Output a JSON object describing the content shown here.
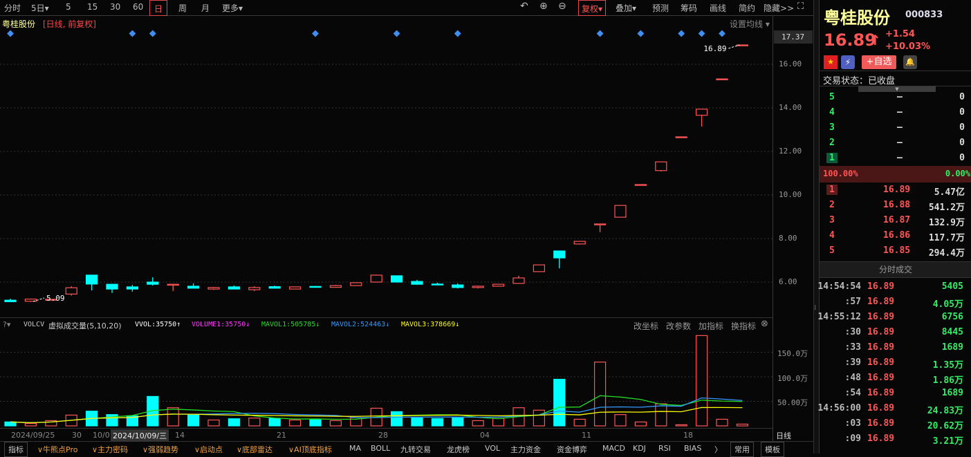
{
  "toolbar": {
    "left": [
      "分时",
      "5日▾",
      "5",
      "15",
      "30",
      "60",
      "日",
      "周",
      "月",
      "更多▾"
    ],
    "selected": "日",
    "right": [
      "复权▾",
      "叠加▾",
      "预测",
      "筹码",
      "画线",
      "简约",
      "隐藏>>"
    ],
    "icons": [
      "undo-icon",
      "zoom-in-icon",
      "zoom-out-icon",
      "fullscreen-icon"
    ]
  },
  "chart": {
    "stock_name": "粤桂股份",
    "mode": "[日线, 前复权]",
    "ma_setting": "设置均线 ▾",
    "price_labels": [
      "16.00",
      "14.00",
      "12.00",
      "10.00",
      "8.00",
      "6.00"
    ],
    "current_price_label": "17.37",
    "high_annotation": "16.89",
    "low_annotation": "5.09",
    "colors": {
      "up": "#ff5555",
      "down": "#00ffff",
      "marker": "#3f8ef0"
    }
  },
  "chart_data": {
    "type": "candlestick",
    "dates": [
      "09/25",
      "09/26",
      "09/27",
      "09/30",
      "10/08",
      "10/09",
      "10/10",
      "10/11",
      "10/14",
      "10/15",
      "10/16",
      "10/17",
      "10/18",
      "10/21",
      "10/22",
      "10/23",
      "10/24",
      "10/25",
      "10/28",
      "10/29",
      "10/30",
      "10/31",
      "11/01",
      "11/04",
      "11/05",
      "11/06",
      "11/07",
      "11/08",
      "11/11",
      "11/12",
      "11/13",
      "11/14",
      "11/15",
      "11/18",
      "11/19",
      "11/20",
      "11/21"
    ],
    "ohlc": [
      [
        5.17,
        5.24,
        5.08,
        5.1
      ],
      [
        5.12,
        5.24,
        5.09,
        5.22
      ],
      [
        5.2,
        5.22,
        5.19,
        5.21
      ],
      [
        5.45,
        5.81,
        5.38,
        5.74
      ],
      [
        6.32,
        6.33,
        5.62,
        5.91
      ],
      [
        5.9,
        5.9,
        5.5,
        5.68
      ],
      [
        5.78,
        5.87,
        5.56,
        5.68
      ],
      [
        6.0,
        6.22,
        5.84,
        5.9
      ],
      [
        5.89,
        5.9,
        5.59,
        5.9
      ],
      [
        5.81,
        5.94,
        5.72,
        5.72
      ],
      [
        5.68,
        5.78,
        5.64,
        5.75
      ],
      [
        5.78,
        5.84,
        5.68,
        5.68
      ],
      [
        5.65,
        5.81,
        5.59,
        5.75
      ],
      [
        5.79,
        5.84,
        5.72,
        5.72
      ],
      [
        5.68,
        5.8,
        5.68,
        5.78
      ],
      [
        5.8,
        5.82,
        5.77,
        5.79
      ],
      [
        5.76,
        5.87,
        5.76,
        5.84
      ],
      [
        5.84,
        5.99,
        5.84,
        5.97
      ],
      [
        6.0,
        6.34,
        5.99,
        6.32
      ],
      [
        6.29,
        6.29,
        6.0,
        6.0
      ],
      [
        6.03,
        6.1,
        5.87,
        5.9
      ],
      [
        5.91,
        5.97,
        5.88,
        5.88
      ],
      [
        5.87,
        5.94,
        5.71,
        5.75
      ],
      [
        5.75,
        5.84,
        5.71,
        5.81
      ],
      [
        5.81,
        5.9,
        5.81,
        5.9
      ],
      [
        5.94,
        6.29,
        5.94,
        6.19
      ],
      [
        6.48,
        6.79,
        6.48,
        6.79
      ],
      [
        7.43,
        7.43,
        6.63,
        7.11
      ],
      [
        7.75,
        7.87,
        7.72,
        7.87
      ],
      [
        8.66,
        8.67,
        8.29,
        8.67
      ],
      [
        8.98,
        9.52,
        8.98,
        9.52
      ],
      [
        10.48,
        10.48,
        10.48,
        10.48
      ],
      [
        11.12,
        11.52,
        11.08,
        11.52
      ],
      [
        12.67,
        12.67,
        12.67,
        12.67
      ],
      [
        13.66,
        13.94,
        13.14,
        13.94
      ],
      [
        15.33,
        15.33,
        15.33,
        15.33
      ],
      [
        16.89,
        16.89,
        16.89,
        16.89
      ]
    ],
    "signal_marker_indices": [
      0,
      6,
      7,
      15,
      19,
      22,
      29,
      31,
      33,
      34,
      35
    ],
    "volume_wan": [
      8,
      5,
      10.7,
      22,
      30,
      23,
      20.5,
      60,
      37,
      22,
      12,
      14.5,
      16,
      15.4,
      12,
      13,
      10.7,
      17,
      36,
      29,
      16.3,
      15,
      16.3,
      10.7,
      15,
      37,
      32,
      95,
      13.5,
      130,
      23,
      8,
      45,
      2.3,
      184,
      13.5,
      3.6
    ],
    "volume_axis_labels": [
      "150.0万",
      "100.0万",
      "50.00万"
    ],
    "date_axis_labels": [
      "2024/09/25",
      "30",
      "10/0",
      "14",
      "21",
      "28",
      "04",
      "11",
      "18"
    ],
    "ylim": [
      4.7,
      17.6
    ]
  },
  "volume_panel": {
    "name": "VOLCV",
    "title": "虚拟成交量(5,10,20)",
    "vvol": "VVOL:35750↑",
    "volume1": "VOLUME1:35750↓",
    "mavol1": "MAVOL1:505785↓",
    "mavol2": "MAVOL2:524463↓",
    "mavol3": "MAVOL3:378669↓",
    "actions": [
      "改坐标",
      "改参数",
      "加指标",
      "换指标"
    ],
    "colors": {
      "volume1": "#ff33ff",
      "mavol1": "#22dd22",
      "mavol2": "#3399ff",
      "mavol3": "#ffff00"
    }
  },
  "date_axis": {
    "tooltip": "2024/10/09/三",
    "period": "日线"
  },
  "bottom_tabs": {
    "first": "指标",
    "custom": [
      "∨牛熊点Pro",
      "∨主力密码",
      "∨强弱趋势",
      "∨启动点",
      "∨底部雷达",
      "∨AI顶底指标"
    ],
    "standard": [
      "MA",
      "BOLL",
      "九转交易",
      "龙虎榜",
      "VOL",
      "主力资金",
      "资金博弈",
      "MACD",
      "KDJ",
      "RSI",
      "BIAS"
    ],
    "more": "〉",
    "common": "常用",
    "template": "模板"
  },
  "quote": {
    "name": "粤桂股份",
    "code": "000833",
    "price": "16.89",
    "arrow": "↑",
    "change": "+1.54",
    "change_pct": "+10.03%",
    "watch_button": "+自选",
    "status": "交易状态：已收盘",
    "asks": [
      {
        "level": "5",
        "price": "—",
        "vol": "0"
      },
      {
        "level": "4",
        "price": "—",
        "vol": "0"
      },
      {
        "level": "3",
        "price": "—",
        "vol": "0"
      },
      {
        "level": "2",
        "price": "—",
        "vol": "0"
      },
      {
        "level": "1",
        "price": "—",
        "vol": "0"
      }
    ],
    "ratio_buy": "100.00%",
    "ratio_sell": "0.00%",
    "bids": [
      {
        "level": "1",
        "price": "16.89",
        "vol": "5.47亿"
      },
      {
        "level": "2",
        "price": "16.88",
        "vol": "541.2万"
      },
      {
        "level": "3",
        "price": "16.87",
        "vol": "132.9万"
      },
      {
        "level": "4",
        "price": "16.86",
        "vol": "117.7万"
      },
      {
        "level": "5",
        "price": "16.85",
        "vol": "294.4万"
      }
    ],
    "trades_title": "分时成交",
    "trades": [
      {
        "t": "14:54:54",
        "p": "16.89",
        "v": "5405"
      },
      {
        "t": ":57",
        "p": "16.89",
        "v": "4.05万"
      },
      {
        "t": "14:55:12",
        "p": "16.89",
        "v": "6756"
      },
      {
        "t": ":30",
        "p": "16.89",
        "v": "8445"
      },
      {
        "t": ":33",
        "p": "16.89",
        "v": "1689"
      },
      {
        "t": ":39",
        "p": "16.89",
        "v": "1.35万"
      },
      {
        "t": ":48",
        "p": "16.89",
        "v": "1.86万"
      },
      {
        "t": ":54",
        "p": "16.89",
        "v": "1689"
      },
      {
        "t": "14:56:00",
        "p": "16.89",
        "v": "24.83万"
      },
      {
        "t": ":03",
        "p": "16.89",
        "v": "20.62万"
      },
      {
        "t": ":09",
        "p": "16.89",
        "v": "3.21万"
      }
    ]
  }
}
